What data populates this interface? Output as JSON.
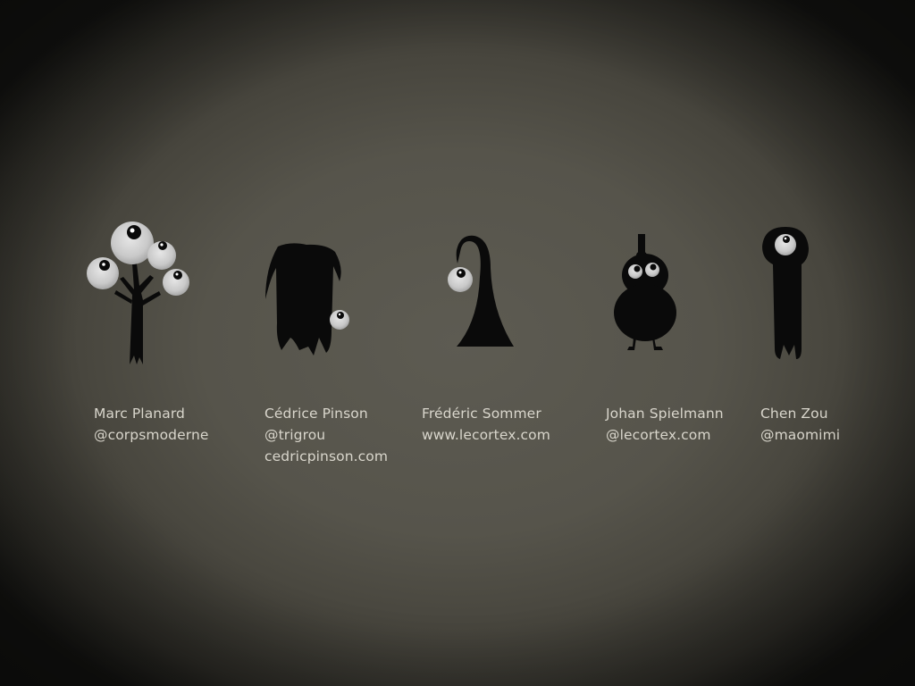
{
  "credits": [
    {
      "name": "Marc Planard",
      "lines": [
        "@corpsmoderne"
      ]
    },
    {
      "name": "Cédrice Pinson",
      "lines": [
        "@trigrou",
        "cedricpinson.com"
      ]
    },
    {
      "name": "Frédéric Sommer",
      "lines": [
        "www.lecortex.com"
      ]
    },
    {
      "name": "Johan Spielmann",
      "lines": [
        "@lecortex.com"
      ]
    },
    {
      "name": "Chen Zou",
      "lines": [
        "@maomimi"
      ]
    }
  ],
  "characters": [
    {
      "icon": "eyeball-tree-icon"
    },
    {
      "icon": "hooded-creature-icon"
    },
    {
      "icon": "leaning-cone-creature-icon"
    },
    {
      "icon": "snowman-creature-icon"
    },
    {
      "icon": "cyclops-pillar-icon"
    }
  ],
  "colors": {
    "background": "#56544b",
    "text": "#d9d6cc",
    "silhouette": "#0a0a0a",
    "eye": "#cfcfcf"
  }
}
